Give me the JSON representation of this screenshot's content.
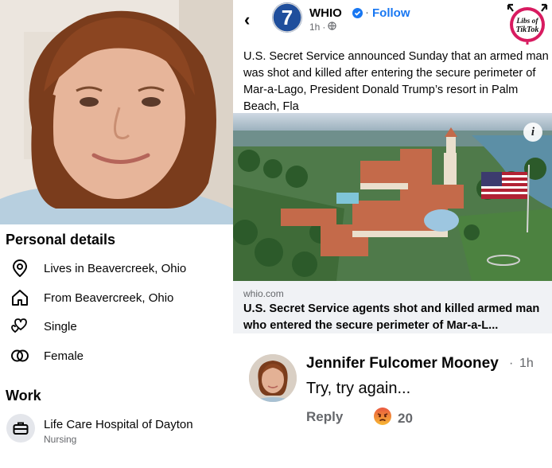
{
  "profile": {
    "personal_details_heading": "Personal details",
    "details": [
      {
        "icon": "location-pin-icon",
        "text": "Lives in Beavercreek, Ohio"
      },
      {
        "icon": "home-icon",
        "text": "From Beavercreek, Ohio"
      },
      {
        "icon": "hearts-icon",
        "text": "Single"
      },
      {
        "icon": "gender-rings-icon",
        "text": "Female"
      }
    ],
    "work_heading": "Work",
    "work": {
      "icon": "briefcase-icon",
      "employer": "Life Care Hospital of Dayton",
      "role": "Nursing"
    }
  },
  "post": {
    "page_name": "WHIO",
    "follow_label": "Follow",
    "time": "1h",
    "logo_text": "7",
    "badge_text": [
      "Libs of",
      "TikTok"
    ],
    "text": "U.S. Secret Service announced Sunday that an armed man was shot and killed after entering the secure perimeter of Mar-a-Lago, President Donald Trump’s resort in Palm Beach, Fla",
    "link_domain": "whio.com",
    "link_title": "U.S. Secret Service agents shot and killed armed man who entered the secure perimeter of Mar-a-L..."
  },
  "comment": {
    "author": "Jennifer Fulcomer Mooney",
    "separator": "·",
    "time": "1h",
    "body": "Try, try again...",
    "reply_label": "Reply",
    "reaction": "angry-emoji-icon",
    "reaction_count": "20"
  },
  "colors": {
    "link_blue": "#1877f2",
    "secondary_text": "#65676b",
    "link_card_bg": "#f0f2f5"
  }
}
